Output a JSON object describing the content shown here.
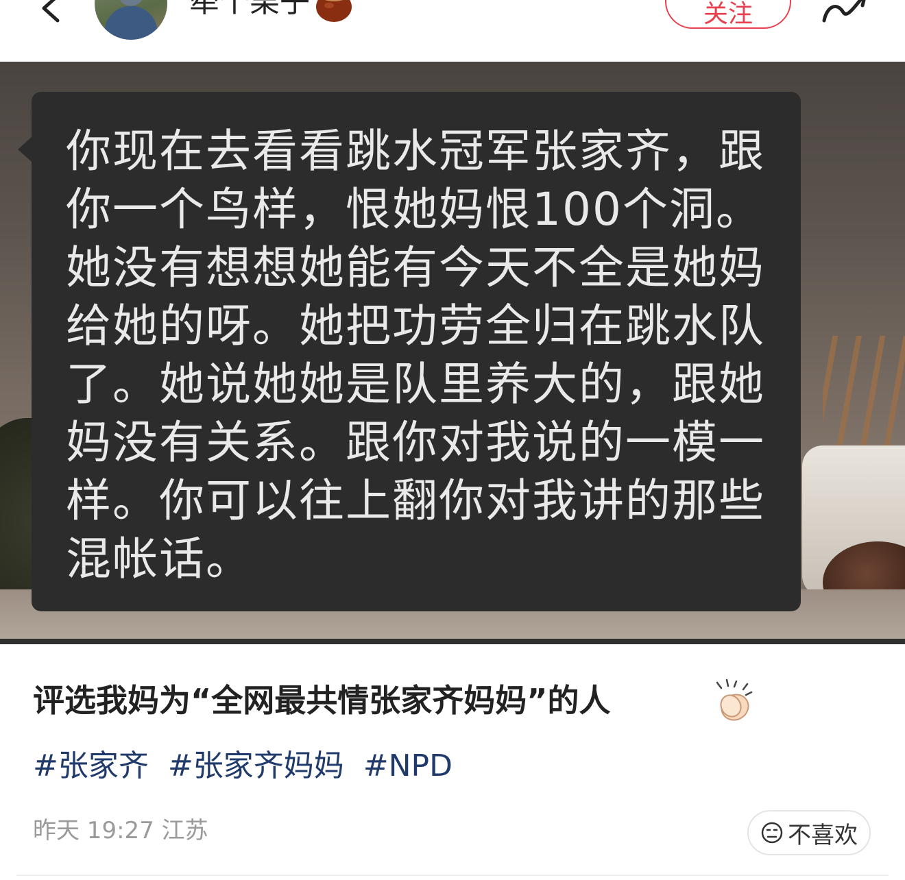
{
  "header": {
    "username": "牵个栗子",
    "follow_label": "关注"
  },
  "image": {
    "bubble_text": "你现在去看看跳水冠军张家齐，跟你一个鸟样，恨她妈恨100个洞。她没有想想她能有今天不全是她妈给她的呀。她把功劳全归在跳水队了。她说她她是队里养大的，跟她妈没有关系。跟你对我说的一模一样。你可以往上翻你对我讲的那些混帐话。"
  },
  "post": {
    "title": "评选我妈为“全网最共情张家齐妈妈”的人",
    "tags": [
      "#张家齐",
      "#张家齐妈妈",
      "#NPD"
    ],
    "meta": "昨天 19:27 江苏",
    "dislike_label": "不喜欢"
  },
  "colors": {
    "accent": "#e8404e",
    "tag": "#1f3a6b",
    "meta": "#9a9a9a",
    "bubble": "#2c2c2c"
  }
}
